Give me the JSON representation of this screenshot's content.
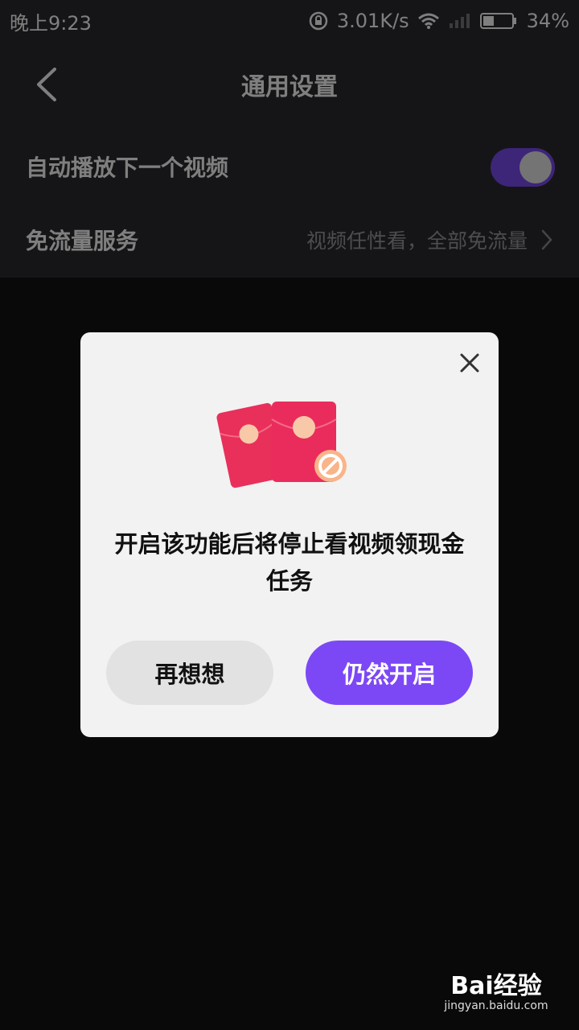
{
  "status_bar": {
    "time": "晚上9:23",
    "speed": "3.01K/s",
    "battery": "34%"
  },
  "header": {
    "title": "通用设置"
  },
  "settings": {
    "autoplay_label": "自动播放下一个视频",
    "autoplay_on": true,
    "free_data_label": "免流量服务",
    "free_data_value": "视频任性看，全部免流量"
  },
  "dialog": {
    "message": "开启该功能后将停止看视频领现金任务",
    "cancel_label": "再想想",
    "confirm_label": "仍然开启"
  },
  "watermark": {
    "logo": "Bai经验",
    "url": "jingyan.baidu.com"
  },
  "colors": {
    "accent": "#7c48f5",
    "background": "#121214",
    "dialog_bg": "#f2f2f2",
    "envelope": "#e8305a"
  }
}
